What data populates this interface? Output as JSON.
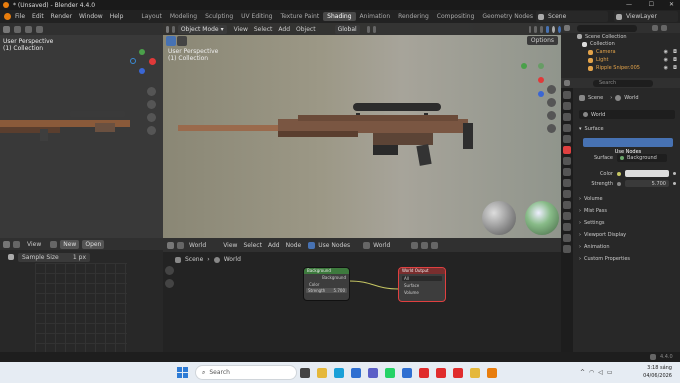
{
  "window": {
    "title": "* (Unsaved) - Blender 4.4.0"
  },
  "menubar": {
    "items": [
      "File",
      "Edit",
      "Render",
      "Window",
      "Help"
    ]
  },
  "workspaces": [
    "Layout",
    "Modeling",
    "Sculpting",
    "UV Editing",
    "Texture Paint",
    "Shading",
    "Animation",
    "Rendering",
    "Compositing",
    "Geometry Nodes",
    "Scripting"
  ],
  "top_right": {
    "scene": "Scene",
    "view_layer": "ViewLayer"
  },
  "file_view": {
    "overlay1": "User Perspective",
    "overlay2": "(1) Collection"
  },
  "viewport": {
    "mode": "Object Mode",
    "menu": [
      "View",
      "Select",
      "Add",
      "Object"
    ],
    "transform": "Global",
    "options": "Options",
    "overlay1": "User Perspective",
    "overlay2": "(1) Collection"
  },
  "image_editor": {
    "view": "View",
    "new": "New",
    "open": "Open",
    "sample_label": "Sample Size",
    "sample_value": "1 px"
  },
  "node_editor": {
    "world": "World",
    "menu": [
      "View",
      "Select",
      "Add",
      "Node"
    ],
    "use_nodes": "Use Nodes",
    "world_name": "World",
    "breadcrumb_scene": "Scene",
    "breadcrumb_world": "World"
  },
  "nodes": {
    "background": {
      "title": "Background",
      "output": "Background",
      "color": "Color",
      "strength_label": "Strength",
      "strength_value": "5.700"
    },
    "output": {
      "title": "World Output",
      "target": "All",
      "surface": "Surface",
      "volume": "Volume"
    }
  },
  "outliner": {
    "title": "Scene Collection",
    "collection": "Collection",
    "items": [
      "Camera",
      "Light",
      "Ripple Sniper.005"
    ]
  },
  "properties": {
    "search_placeholder": "Search",
    "breadcrumb_scene": "Scene",
    "breadcrumb_world": "World",
    "world_name": "World",
    "surface_panel": "Surface",
    "use_nodes_btn": "Use Nodes",
    "surface_label": "Surface",
    "surface_value": "Background",
    "color_label": "Color",
    "strength_label": "Strength",
    "strength_value": "5.700",
    "panels": [
      "Volume",
      "Mist Pass",
      "Settings",
      "Viewport Display",
      "Animation",
      "Custom Properties"
    ]
  },
  "statusbar": {
    "version": "4.4.0"
  },
  "taskbar": {
    "search_placeholder": "Search",
    "time": "3:18 sáng",
    "date": "04/06/2026",
    "colors": {
      "start": "#2d7bd5",
      "edge": "#1aa0d8",
      "chrome": "#e5b83b",
      "opera": "#e02c2c",
      "store": "#2f6fd1"
    }
  }
}
